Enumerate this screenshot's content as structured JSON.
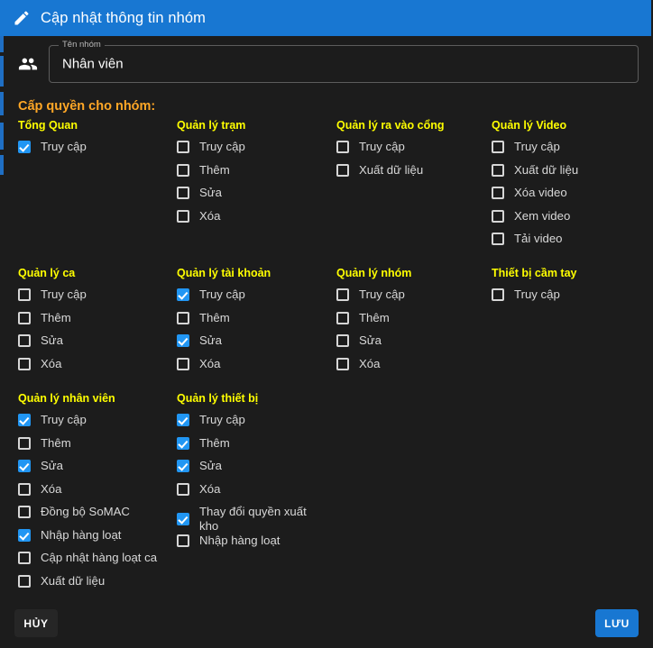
{
  "header": {
    "title": "Cập nhật thông tin nhóm",
    "icon": "pencil-icon",
    "background": "#1877d2"
  },
  "name_field": {
    "icon": "group-people-icon",
    "label": "Tên nhóm",
    "value": "Nhân viên",
    "placeholder": "Tên nhóm"
  },
  "permissions": {
    "section_title": "Cấp quyền cho nhóm:",
    "title_color": "#ffa726",
    "group_color": "#ffff00",
    "checked_color": "#2196f3",
    "rows": [
      {
        "columns": [
          {
            "name": "Tổng Quan",
            "options": [
              {
                "label": "Truy cập",
                "checked": true
              }
            ]
          },
          {
            "name": "Quản lý trạm",
            "options": [
              {
                "label": "Truy cập",
                "checked": false
              },
              {
                "label": "Thêm",
                "checked": false
              },
              {
                "label": "Sửa",
                "checked": false
              },
              {
                "label": "Xóa",
                "checked": false
              }
            ]
          },
          {
            "name": "Quản lý ra vào cổng",
            "options": [
              {
                "label": "Truy cập",
                "checked": false
              },
              {
                "label": "Xuất dữ liệu",
                "checked": false
              }
            ]
          },
          {
            "name": "Quản lý Video",
            "options": [
              {
                "label": "Truy cập",
                "checked": false
              },
              {
                "label": "Xuất dữ liệu",
                "checked": false
              },
              {
                "label": "Xóa video",
                "checked": false
              },
              {
                "label": "Xem video",
                "checked": false
              },
              {
                "label": "Tải video",
                "checked": false
              }
            ]
          }
        ]
      },
      {
        "columns": [
          {
            "name": "Quản lý ca",
            "options": [
              {
                "label": "Truy cập",
                "checked": false
              },
              {
                "label": "Thêm",
                "checked": false
              },
              {
                "label": "Sửa",
                "checked": false
              },
              {
                "label": "Xóa",
                "checked": false
              }
            ]
          },
          {
            "name": "Quản lý tài khoản",
            "options": [
              {
                "label": "Truy cập",
                "checked": true
              },
              {
                "label": "Thêm",
                "checked": false
              },
              {
                "label": "Sửa",
                "checked": true
              },
              {
                "label": "Xóa",
                "checked": false
              }
            ]
          },
          {
            "name": "Quản lý nhóm",
            "options": [
              {
                "label": "Truy cập",
                "checked": false
              },
              {
                "label": "Thêm",
                "checked": false
              },
              {
                "label": "Sửa",
                "checked": false
              },
              {
                "label": "Xóa",
                "checked": false
              }
            ]
          },
          {
            "name": "Thiết bị cầm tay",
            "options": [
              {
                "label": "Truy cập",
                "checked": false
              }
            ]
          }
        ]
      },
      {
        "columns": [
          {
            "name": "Quản lý nhân viên",
            "options": [
              {
                "label": "Truy cập",
                "checked": true
              },
              {
                "label": "Thêm",
                "checked": false
              },
              {
                "label": "Sửa",
                "checked": true
              },
              {
                "label": "Xóa",
                "checked": false
              },
              {
                "label": "Đồng bộ SoMAC",
                "checked": false
              },
              {
                "label": "Nhập hàng loạt",
                "checked": true
              },
              {
                "label": "Cập nhật hàng loạt ca",
                "checked": false
              },
              {
                "label": "Xuất dữ liệu",
                "checked": false
              }
            ]
          },
          {
            "name": "Quản lý thiết bị",
            "options": [
              {
                "label": "Truy cập",
                "checked": true
              },
              {
                "label": "Thêm",
                "checked": true
              },
              {
                "label": "Sửa",
                "checked": true
              },
              {
                "label": "Xóa",
                "checked": false
              },
              {
                "label": "Thay đổi quyền xuất kho",
                "checked": true,
                "wrap": true
              },
              {
                "label": "Nhập hàng loạt",
                "checked": false
              }
            ]
          }
        ]
      }
    ]
  },
  "footer": {
    "cancel_label": "HỦY",
    "save_label": "LƯU",
    "save_color": "#1877d2"
  }
}
